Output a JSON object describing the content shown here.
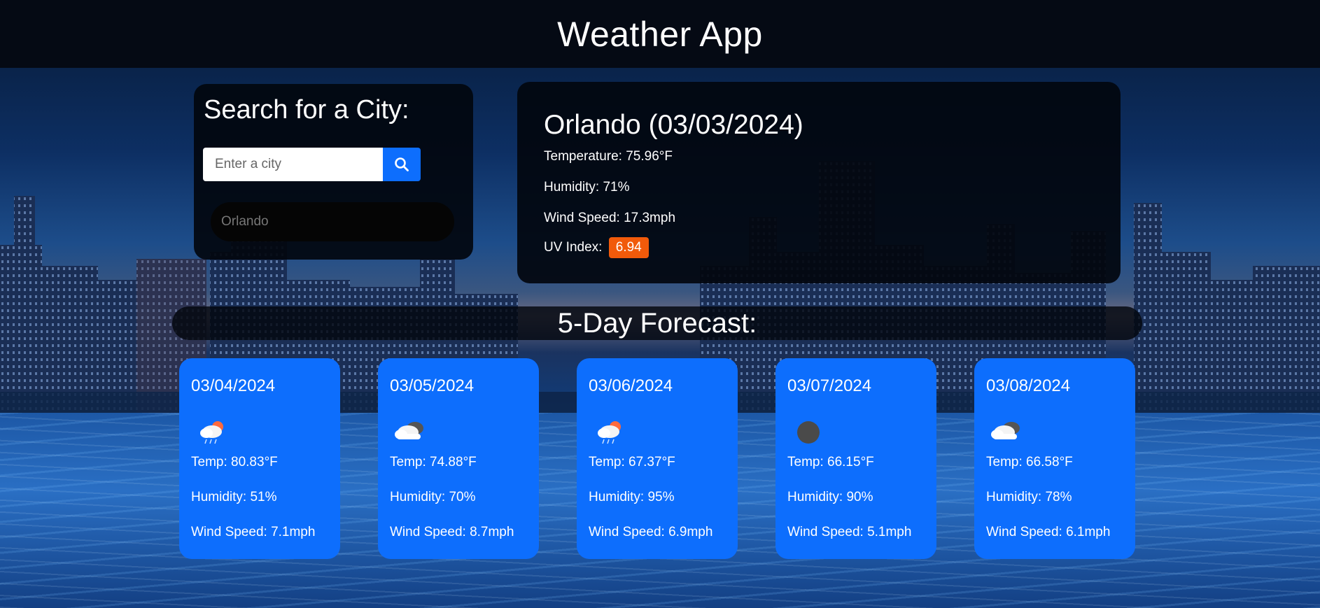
{
  "header": {
    "title": "Weather App"
  },
  "search": {
    "heading": "Search for a City:",
    "placeholder": "Enter a city",
    "history": [
      "Orlando"
    ]
  },
  "current": {
    "heading": "Orlando (03/03/2024)",
    "temperature": "Temperature: 75.96°F",
    "humidity": "Humidity: 71%",
    "wind": "Wind Speed: 17.3mph",
    "uv_label": "UV Index:",
    "uv_value": "6.94",
    "uv_color": "#f15a0a"
  },
  "forecast": {
    "heading": "5-Day Forecast:",
    "days": [
      {
        "date": "03/04/2024",
        "icon": "rain-cloud-sun-icon",
        "temp": "Temp: 80.83°F",
        "humidity": "Humidity: 51%",
        "wind": "Wind Speed: 7.1mph"
      },
      {
        "date": "03/05/2024",
        "icon": "broken-clouds-icon",
        "temp": "Temp: 74.88°F",
        "humidity": "Humidity: 70%",
        "wind": "Wind Speed: 8.7mph"
      },
      {
        "date": "03/06/2024",
        "icon": "rain-cloud-sun-icon",
        "temp": "Temp: 67.37°F",
        "humidity": "Humidity: 95%",
        "wind": "Wind Speed: 6.9mph"
      },
      {
        "date": "03/07/2024",
        "icon": "overcast-dot-icon",
        "temp": "Temp: 66.15°F",
        "humidity": "Humidity: 90%",
        "wind": "Wind Speed: 5.1mph"
      },
      {
        "date": "03/08/2024",
        "icon": "broken-clouds-icon",
        "temp": "Temp: 66.58°F",
        "humidity": "Humidity: 78%",
        "wind": "Wind Speed: 6.1mph"
      }
    ]
  },
  "colors": {
    "accent": "#0d6efd",
    "header_bg": "#050a14"
  }
}
